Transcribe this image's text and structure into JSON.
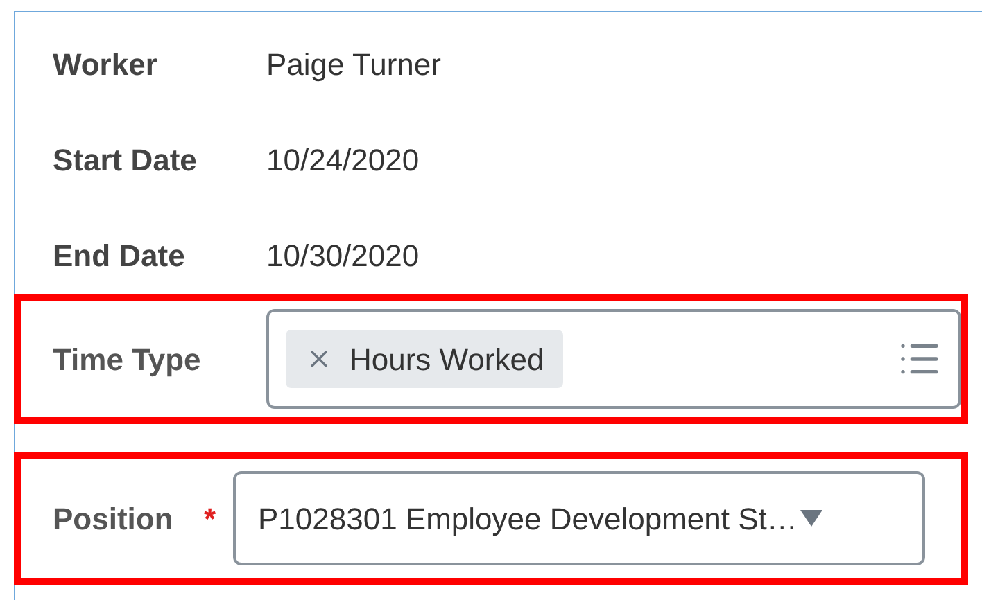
{
  "details": [
    {
      "label": "Worker",
      "value": "Paige Turner"
    },
    {
      "label": "Start Date",
      "value": "10/24/2020"
    },
    {
      "label": "End Date",
      "value": "10/30/2020"
    }
  ],
  "time_type": {
    "label": "Time Type",
    "highlighted": true,
    "tags": [
      {
        "text": "Hours Worked"
      }
    ]
  },
  "position": {
    "label": "Position",
    "required_mark": "*",
    "highlighted": true,
    "value": "P1028301 Employee Development St…"
  }
}
